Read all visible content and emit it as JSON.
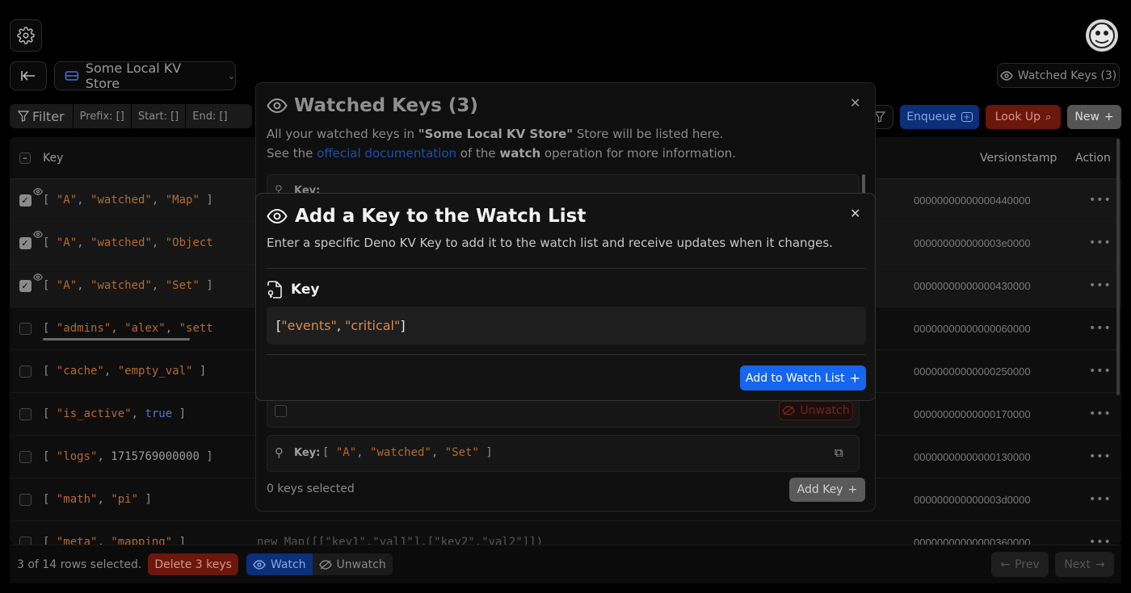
{
  "header": {
    "store_name": "Some Local KV Store",
    "watched_keys_button": "Watched Keys (3)"
  },
  "toolbar": {
    "filter_label": "Filter",
    "prefix_label": "Prefix: []",
    "start_label": "Start: []",
    "end_label": "End: []",
    "enqueue_label": "Enqueue",
    "lookup_label": "Look Up",
    "new_label": "New"
  },
  "table": {
    "columns": {
      "key": "Key",
      "versionstamp": "Versionstamp",
      "action": "Action"
    },
    "rows": [
      {
        "selected": true,
        "watched": true,
        "versionstamp": "00000000000000440000"
      },
      {
        "selected": true,
        "watched": true,
        "versionstamp": "000000000000003e0000"
      },
      {
        "selected": true,
        "watched": true,
        "versionstamp": "00000000000000430000"
      },
      {
        "selected": false,
        "watched": false,
        "versionstamp": "00000000000000060000"
      },
      {
        "selected": false,
        "watched": false,
        "versionstamp": "00000000000000250000"
      },
      {
        "selected": false,
        "watched": false,
        "versionstamp": "00000000000000170000"
      },
      {
        "selected": false,
        "watched": false,
        "versionstamp": "00000000000000130000"
      },
      {
        "selected": false,
        "watched": false,
        "versionstamp": "000000000000003d0000"
      },
      {
        "selected": false,
        "watched": false,
        "versionstamp": "00000000000000360000"
      }
    ],
    "row_keys": [
      [
        "A",
        "watched",
        "Map"
      ],
      [
        "A",
        "watched",
        "Object"
      ],
      [
        "A",
        "watched",
        "Set"
      ],
      [
        "admins",
        "alex",
        "settings"
      ],
      [
        "cache",
        "empty_val"
      ],
      [
        "is_active",
        "true"
      ],
      [
        "logs",
        "1715769000000"
      ],
      [
        "math",
        "pi"
      ],
      [
        "meta",
        "mapping"
      ]
    ],
    "partial_value": "new Map([[\"key1\",\"val1\"],[\"key2\",\"val2\"]])"
  },
  "footer": {
    "selection_status": "3 of 14 rows selected.",
    "delete_label": "Delete 3 keys",
    "watch_label": "Watch",
    "unwatch_label": "Unwatch",
    "prev_label": "Prev",
    "next_label": "Next"
  },
  "watched_dialog": {
    "title": "Watched Keys (3)",
    "desc_prefix": "All your watched keys in ",
    "desc_store": "\"Some Local KV Store\"",
    "desc_suffix": " Store will be listed here.",
    "desc2_prefix": "See the ",
    "desc2_link": "offecial documentation",
    "desc2_mid": " of the ",
    "desc2_bold": "watch",
    "desc2_suffix": " operation for more information.",
    "key_label": "Key:",
    "unwatch_label": "Unwatch",
    "selected_status": "0 keys selected",
    "add_key_label": "Add Key"
  },
  "add_dialog": {
    "title": "Add a Key to the Watch List",
    "description": "Enter a specific Deno KV Key to add it to the watch list and receive updates when it changes.",
    "key_section_label": "Key",
    "key_input_value": "[\"events\", \"critical\"]",
    "submit_label": "Add to Watch List"
  },
  "colors": {
    "primary_blue": "#1565f0",
    "danger_red": "#b3200f",
    "string_orange": "#d9894a"
  }
}
